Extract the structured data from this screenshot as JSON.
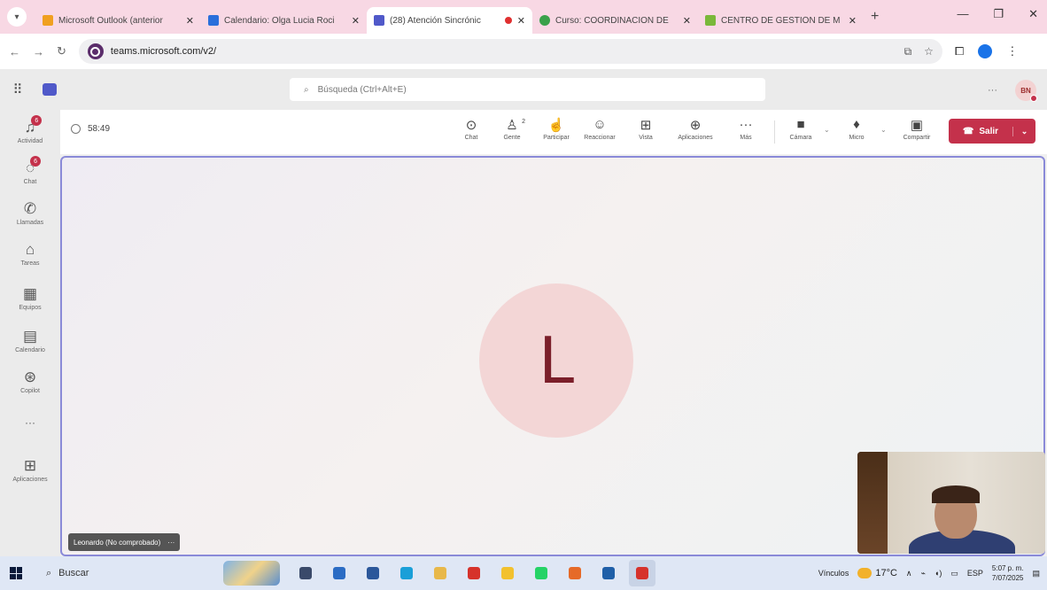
{
  "browser": {
    "tabs": [
      {
        "title": "Microsoft Outlook (anterior",
        "favicon_color": "#f0a020",
        "active": false
      },
      {
        "title": "Calendario: Olga Lucia Roci",
        "favicon_color": "#2a6fdb",
        "active": false
      },
      {
        "title": "(28) Atención Sincrónic",
        "favicon_color": "#5059c9",
        "active": true,
        "recording": true
      },
      {
        "title": "Curso: COORDINACION DE",
        "favicon_color": "#3aa14a",
        "active": false
      },
      {
        "title": "CENTRO DE GESTIÓN DE M",
        "favicon_color": "#7ab83a",
        "active": false
      }
    ],
    "url": "teams.microsoft.com/v2/"
  },
  "teams": {
    "search_placeholder": "Búsqueda (Ctrl+Alt+E)",
    "user_initials": "BN",
    "rail": [
      {
        "id": "activity",
        "icon": "bell-icon",
        "label": "Actividad",
        "badge": "6"
      },
      {
        "id": "chat",
        "icon": "chat-icon",
        "label": "Chat",
        "badge": "6"
      },
      {
        "id": "calls",
        "icon": "phone-icon",
        "label": "Llamadas"
      },
      {
        "id": "tasks",
        "icon": "tasks-icon",
        "label": "Tareas"
      },
      {
        "id": "teams",
        "icon": "teams-icon",
        "label": "Equipos"
      },
      {
        "id": "calendar",
        "icon": "calendar-icon",
        "label": "Calendario"
      },
      {
        "id": "copilot",
        "icon": "copilot-icon",
        "label": "Copilot"
      },
      {
        "id": "more",
        "icon": "more-icon",
        "label": ""
      },
      {
        "id": "apps",
        "icon": "apps-icon",
        "label": "Aplicaciones"
      }
    ]
  },
  "meeting": {
    "timer": "58:49",
    "participant_count": "2",
    "tools": [
      {
        "id": "chat",
        "icon": "chat-icon",
        "label": "Chat"
      },
      {
        "id": "people",
        "icon": "people-icon",
        "label": "Gente"
      },
      {
        "id": "raise",
        "icon": "hand-icon",
        "label": "Participar"
      },
      {
        "id": "react",
        "icon": "smile-icon",
        "label": "Reaccionar"
      },
      {
        "id": "view",
        "icon": "grid-icon",
        "label": "Vista"
      },
      {
        "id": "apps",
        "icon": "plus-icon",
        "label": "Aplicaciones"
      },
      {
        "id": "more",
        "icon": "more-icon",
        "label": "Más"
      }
    ],
    "camera_label": "Cámara",
    "mic_label": "Micro",
    "share_label": "Compartir",
    "leave_label": "Salir",
    "participant_initial": "L",
    "participant_name": "Leonardo (No comprobado)"
  },
  "taskbar": {
    "search_label": "Buscar",
    "apps": [
      {
        "name": "task-view",
        "color": "#3a4a6a"
      },
      {
        "name": "store",
        "color": "#2b6cc4"
      },
      {
        "name": "word",
        "color": "#2b579a"
      },
      {
        "name": "edge",
        "color": "#1a9fd8"
      },
      {
        "name": "files",
        "color": "#e8b84a"
      },
      {
        "name": "acrobat",
        "color": "#d6322b"
      },
      {
        "name": "chrome",
        "color": "#f2c12e"
      },
      {
        "name": "whatsapp",
        "color": "#25d366"
      },
      {
        "name": "firefox",
        "color": "#e66a28"
      },
      {
        "name": "mail",
        "color": "#1f5fa8"
      },
      {
        "name": "photos",
        "color": "#d6322b",
        "active": true
      }
    ],
    "vinculos": "Vínculos",
    "temperature": "17°C",
    "language": "ESP",
    "time": "5:07 p. m.",
    "date": "7/07/2025"
  }
}
